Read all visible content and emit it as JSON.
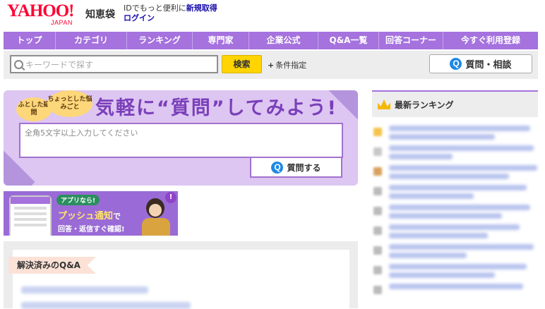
{
  "header": {
    "logo": "YAHOO!",
    "logo_sub": "JAPAN",
    "service": "知恵袋",
    "login_desc": "IDでもっと便利に",
    "register_link": "新規取得",
    "login_link": "ログイン"
  },
  "nav": {
    "items": [
      "トップ",
      "カテゴリ",
      "ランキング",
      "専門家",
      "企業公式",
      "Q&A一覧",
      "回答コーナー",
      "今すぐ利用登録"
    ]
  },
  "search": {
    "placeholder": "キーワードで探す",
    "button": "検索",
    "conditions": "条件指定",
    "ask_button": "質問・相談"
  },
  "question_box": {
    "bubble_left": "ふとした疑問",
    "bubble_right": "ちょっとした悩みごと",
    "title": "気軽に“質問”してみよう!",
    "placeholder": "全角5文字以上入力してください",
    "submit": "質問する"
  },
  "app_banner": {
    "tag": "アプリなら!",
    "push_highlight": "プッシュ通知",
    "push_suffix": "で",
    "sub": "回答・返信すぐ確認!",
    "badge": "!"
  },
  "solved": {
    "label": "解決済みのQ&A"
  },
  "ranking": {
    "title": "最新ランキング"
  },
  "colors": {
    "nav_purple": "#a572de",
    "search_yellow": "#ffd400",
    "logo_red": "#ff0033",
    "q_blue": "#1e88e5"
  }
}
